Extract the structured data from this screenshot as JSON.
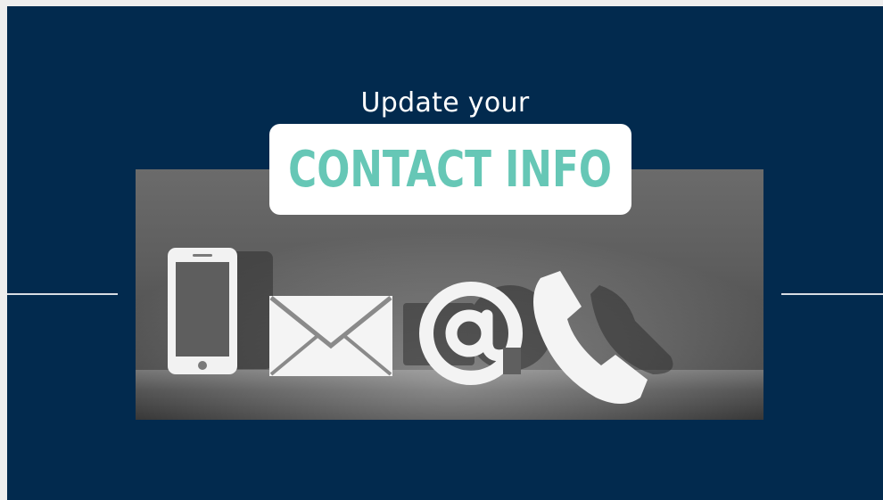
{
  "heading": {
    "subtitle": "Update your",
    "title": "CONTACT INFO"
  },
  "colors": {
    "background": "#022a4e",
    "title_box": "#ffffff",
    "title_text": "#66c7b6",
    "subtitle_text": "#ffffff",
    "rule": "#d8dde3"
  },
  "image": {
    "icons": [
      "smartphone-icon",
      "envelope-icon",
      "at-sign-icon",
      "telephone-handset-icon"
    ]
  }
}
